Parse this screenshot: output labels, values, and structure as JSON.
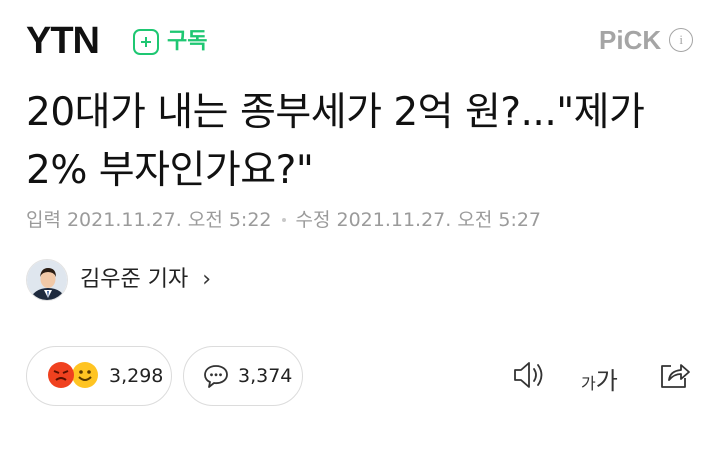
{
  "header": {
    "logo": "YTN",
    "subscribe_label": "구독",
    "pick_label": "PiCK",
    "info_icon": "info-icon"
  },
  "article": {
    "title": "20대가 내는 종부세가 2억 원?...\"제가 2% 부자인가요?\"",
    "input_label": "입력",
    "input_date": "2021.11.27. 오전 5:22",
    "modified_label": "수정",
    "modified_date": "2021.11.27. 오전 5:27"
  },
  "reporter": {
    "name": "김우준 기자",
    "chevron": "›"
  },
  "actions": {
    "reaction_count": "3,298",
    "comment_count": "3,374",
    "font_small": "가",
    "font_big": "가"
  },
  "colors": {
    "accent_green": "#1ec772",
    "muted_gray": "#9b9b9b",
    "angry_red": "#f0411f",
    "smile_yellow": "#ffc422"
  }
}
